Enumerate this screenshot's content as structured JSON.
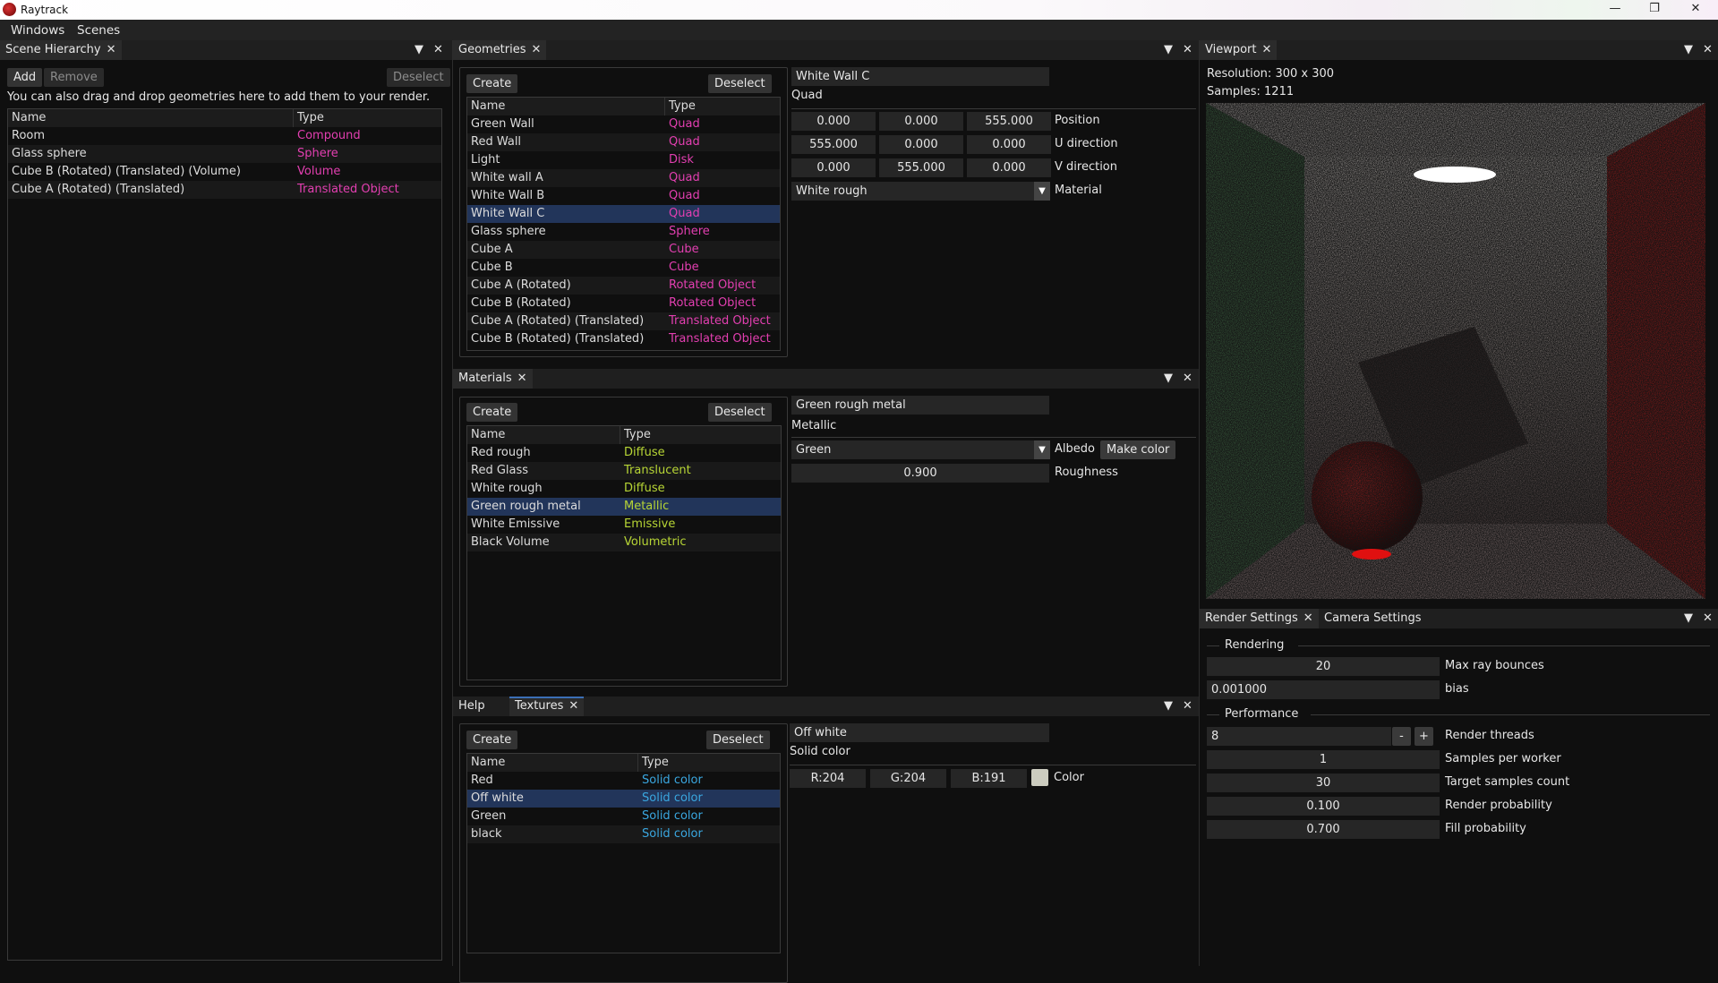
{
  "app": {
    "title": "Raytrack"
  },
  "window_controls": {
    "minimize": "—",
    "maximize": "❐",
    "close": "✕"
  },
  "menu": [
    "Windows",
    "Scenes"
  ],
  "scene_hierarchy": {
    "tab": "Scene Hierarchy",
    "add": "Add",
    "remove": "Remove",
    "deselect": "Deselect",
    "hint": "You can also drag and drop geometries here to add them to your render.",
    "columns": [
      "Name",
      "Type"
    ],
    "rows": [
      [
        "Room",
        "Compound"
      ],
      [
        "Glass sphere",
        "Sphere"
      ],
      [
        "Cube B (Rotated) (Translated) (Volume)",
        "Volume"
      ],
      [
        "Cube A (Rotated) (Translated)",
        "Translated Object"
      ]
    ]
  },
  "geometries": {
    "tab": "Geometries",
    "create": "Create",
    "deselect": "Deselect",
    "columns": [
      "Name",
      "Type"
    ],
    "rows": [
      [
        "Green Wall",
        "Quad"
      ],
      [
        "Red Wall",
        "Quad"
      ],
      [
        "Light",
        "Disk"
      ],
      [
        "White wall A",
        "Quad"
      ],
      [
        "White Wall B",
        "Quad"
      ],
      [
        "White Wall C",
        "Quad"
      ],
      [
        "Glass sphere",
        "Sphere"
      ],
      [
        "Cube A",
        "Cube"
      ],
      [
        "Cube B",
        "Cube"
      ],
      [
        "Cube A (Rotated)",
        "Rotated Object"
      ],
      [
        "Cube B (Rotated)",
        "Rotated Object"
      ],
      [
        "Cube A (Rotated) (Translated)",
        "Translated Object"
      ],
      [
        "Cube B (Rotated) (Translated)",
        "Translated Object"
      ]
    ],
    "selected_index": 5,
    "detail": {
      "name": "White Wall C",
      "type": "Quad",
      "position": [
        "0.000",
        "0.000",
        "555.000"
      ],
      "position_label": "Position",
      "u": [
        "555.000",
        "0.000",
        "0.000"
      ],
      "u_label": "U direction",
      "v": [
        "0.000",
        "555.000",
        "0.000"
      ],
      "v_label": "V direction",
      "material": "White rough",
      "material_label": "Material"
    }
  },
  "materials": {
    "tab": "Materials",
    "create": "Create",
    "deselect": "Deselect",
    "columns": [
      "Name",
      "Type"
    ],
    "rows": [
      [
        "Red rough",
        "Diffuse"
      ],
      [
        "Red Glass",
        "Translucent"
      ],
      [
        "White rough",
        "Diffuse"
      ],
      [
        "Green rough metal",
        "Metallic"
      ],
      [
        "White Emissive",
        "Emissive"
      ],
      [
        "Black Volume",
        "Volumetric"
      ]
    ],
    "selected_index": 3,
    "detail": {
      "name": "Green rough metal",
      "type": "Metallic",
      "albedo": "Green",
      "albedo_label": "Albedo",
      "make_color": "Make color",
      "roughness": "0.900",
      "roughness_label": "Roughness"
    }
  },
  "textures": {
    "tabs": [
      "Help",
      "Textures"
    ],
    "create": "Create",
    "deselect": "Deselect",
    "columns": [
      "Name",
      "Type"
    ],
    "rows": [
      [
        "Red",
        "Solid color"
      ],
      [
        "Off white",
        "Solid color"
      ],
      [
        "Green",
        "Solid color"
      ],
      [
        "black",
        "Solid color"
      ]
    ],
    "selected_index": 1,
    "detail": {
      "name": "Off white",
      "type": "Solid color",
      "r": "R:204",
      "g": "G:204",
      "b": "B:191",
      "swatch": "#ccccbf",
      "color_label": "Color"
    }
  },
  "viewport": {
    "tab": "Viewport",
    "resolution": "Resolution: 300 x 300",
    "samples": "Samples: 1211"
  },
  "render_settings": {
    "tabs": [
      "Render Settings",
      "Camera Settings"
    ],
    "rendering_header": "Rendering",
    "max_bounces": "20",
    "max_bounces_label": "Max ray bounces",
    "bias": "0.001000",
    "bias_label": "bias",
    "performance_header": "Performance",
    "threads": "8",
    "threads_minus": "-",
    "threads_plus": "+",
    "threads_label": "Render threads",
    "samples_per_worker": "1",
    "samples_per_worker_label": "Samples per worker",
    "target_samples": "30",
    "target_samples_label": "Target samples count",
    "render_probability": "0.100",
    "render_probability_label": "Render probability",
    "fill_probability": "0.700",
    "fill_probability_label": "Fill probability"
  },
  "colors": {
    "accent_selected": "#22355a",
    "geometry_type": "#e33fb1",
    "material_type": "#b7d535",
    "texture_type": "#3aa7e0"
  }
}
